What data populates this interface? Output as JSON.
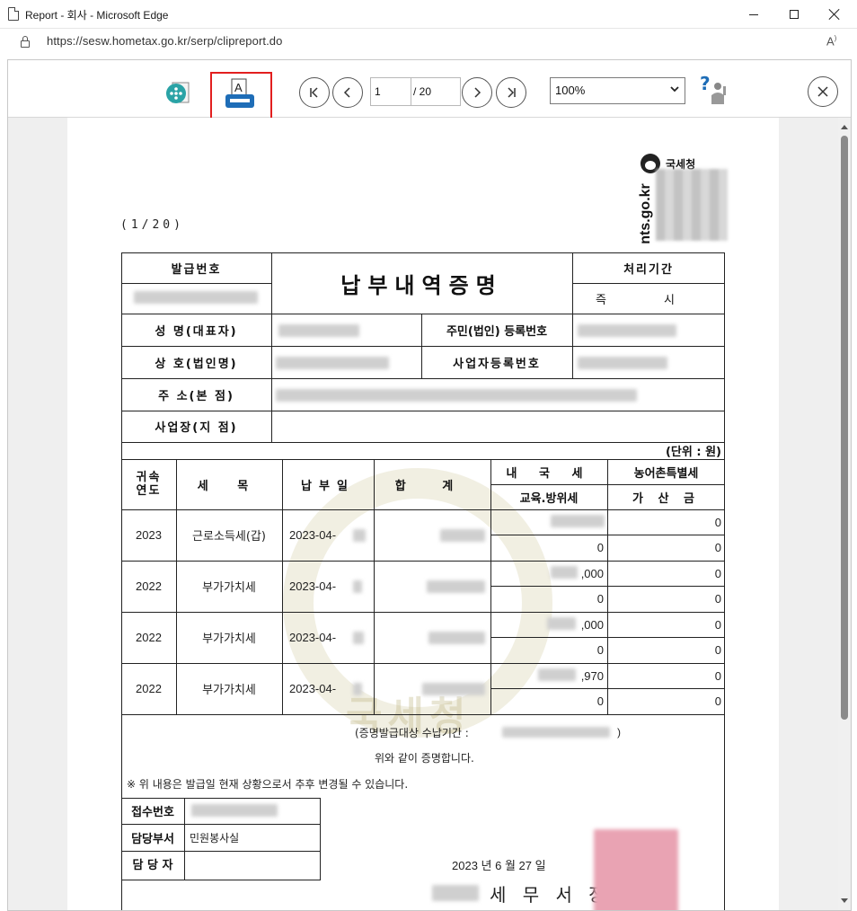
{
  "window": {
    "title": "Report - 회사 - Microsoft Edge",
    "url": "https://sesw.hometax.go.kr/serp/clipreport.do"
  },
  "toolbar": {
    "page_current": "1",
    "page_total": "/ 20",
    "zoom": "100%",
    "highlight_color": "#e21f1f"
  },
  "report": {
    "page_count": "(1/20)",
    "nts_name": "국세청",
    "nts_url": "nts.go.kr",
    "doc_title": "납부내역증명",
    "labels": {
      "issue_no": "발급번호",
      "process_period": "처리기간",
      "process_value": "즉 시",
      "name": "성 명(대표자)",
      "resident_no": "주민(법인) 등록번호",
      "company": "상 호(법인명)",
      "business_no": "사업자등록번호",
      "address": "주 소(본 점)",
      "workplace": "사업장(지 점)",
      "unit": "(단위 : 원)",
      "year": "귀속\n연도",
      "tax_item": "세 목",
      "pay_date": "납부일",
      "total": "합 계",
      "national_tax": "내 국 세",
      "rural_tax": "농어촌특별세",
      "edu_tax": "교육.방위세",
      "penalty": "가 산 금"
    },
    "rows": [
      {
        "year": "2023",
        "item": "근로소득세(갑)",
        "date": "2023-04-",
        "national": "",
        "edu": "0",
        "rural": "0",
        "penalty": "0"
      },
      {
        "year": "2022",
        "item": "부가가치세",
        "date": "2023-04-",
        "national": ",000",
        "edu": "0",
        "rural": "0",
        "penalty": "0"
      },
      {
        "year": "2022",
        "item": "부가가치세",
        "date": "2023-04-",
        "national": ",000",
        "edu": "0",
        "rural": "0",
        "penalty": "0"
      },
      {
        "year": "2022",
        "item": "부가가치세",
        "date": "2023-04-",
        "national": ",970",
        "edu": "0",
        "rural": "0",
        "penalty": "0"
      }
    ],
    "period_note": "(증명발급대상 수납기간 :",
    "period_close": ")",
    "certify": "위와 같이 증명합니다.",
    "notice": "※ 위 내용은 발급일 현재 상황으로서 추후 변경될 수 있습니다.",
    "receipt_no": "접수번호",
    "dept_label": "담당부서",
    "dept_value": "민원봉사실",
    "officer_label": "담 당 자",
    "date": "2023 년 6 월 27 일",
    "office": "세 무 서 장"
  }
}
